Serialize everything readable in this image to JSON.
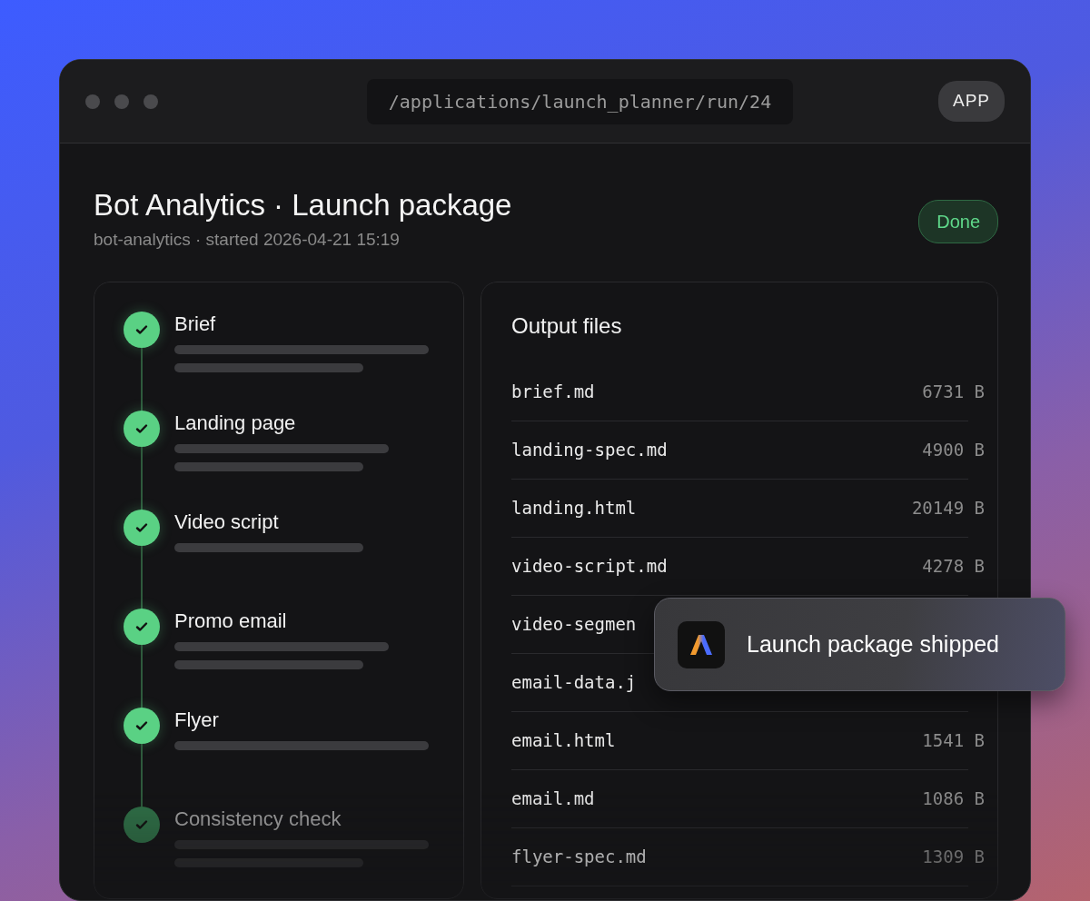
{
  "window": {
    "url": "/applications/launch_planner/run/24",
    "badge": "APP"
  },
  "header": {
    "title": "Bot Analytics · Launch package",
    "subtitle": "bot-analytics · started 2026-04-21 15:19",
    "status": "Done"
  },
  "steps": [
    {
      "label": "Brief",
      "done": true,
      "dimmed": false,
      "skeleton": [
        {
          "kind": "long"
        },
        {
          "kind": "short"
        }
      ]
    },
    {
      "label": "Landing page",
      "done": true,
      "dimmed": false,
      "skeleton": [
        {
          "kind": "medium"
        },
        {
          "kind": "short"
        }
      ]
    },
    {
      "label": "Video script",
      "done": true,
      "dimmed": false,
      "skeleton": [
        {
          "kind": "short"
        }
      ]
    },
    {
      "label": "Promo email",
      "done": true,
      "dimmed": false,
      "skeleton": [
        {
          "kind": "medium"
        },
        {
          "kind": "short"
        }
      ]
    },
    {
      "label": "Flyer",
      "done": true,
      "dimmed": false,
      "skeleton": [
        {
          "kind": "long"
        }
      ]
    },
    {
      "label": "Consistency check",
      "done": true,
      "dimmed": true,
      "skeleton": [
        {
          "kind": "long"
        },
        {
          "kind": "short"
        }
      ]
    }
  ],
  "output_files": {
    "title": "Output files",
    "files": [
      {
        "name": "brief.md",
        "size": "6731 B"
      },
      {
        "name": "landing-spec.md",
        "size": "4900 B"
      },
      {
        "name": "landing.html",
        "size": "20149 B"
      },
      {
        "name": "video-script.md",
        "size": "4278 B"
      },
      {
        "name": "video-segmen"
      },
      {
        "name": "email-data.j"
      },
      {
        "name": "email.html",
        "size": "1541 B"
      },
      {
        "name": "email.md",
        "size": "1086 B"
      },
      {
        "name": "flyer-spec.md",
        "size": "1309 B"
      }
    ]
  },
  "toast": {
    "message": "Launch package shipped"
  }
}
